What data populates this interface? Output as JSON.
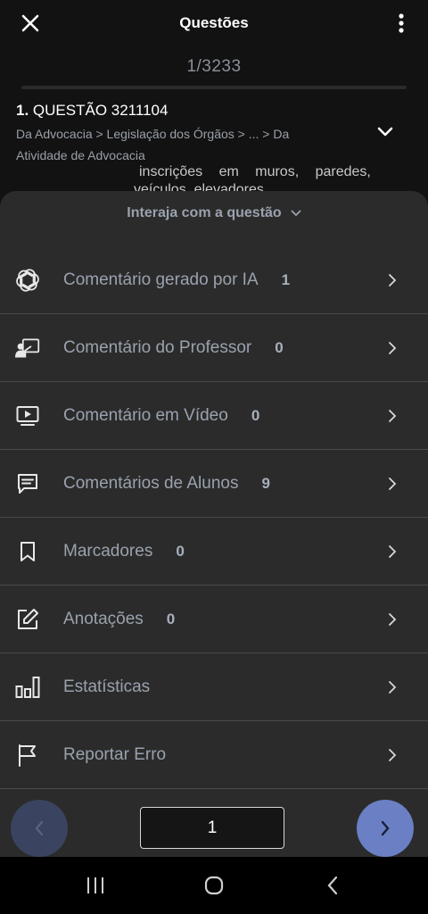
{
  "header": {
    "title": "Questões",
    "close_icon": "close-icon",
    "more_icon": "more-vertical-icon"
  },
  "counter": "1/3233",
  "question": {
    "number": "1.",
    "title": "QUESTÃO 3211104",
    "breadcrumb_line1": "Da Advocacia > Legislação dos Órgãos > ... > Da",
    "breadcrumb_line2": "Atividade de Advocacia",
    "behind_text": "inscrições em muros, paredes,",
    "behind_text2": "veículos, elevadores"
  },
  "sheet": {
    "toggle_label": "Interaja com a questão"
  },
  "menu": {
    "items": [
      {
        "icon": "ai-openai-icon",
        "label": "Comentário gerado por IA",
        "count": "1"
      },
      {
        "icon": "teacher-icon",
        "label": "Comentário do Professor",
        "count": "0"
      },
      {
        "icon": "video-icon",
        "label": "Comentário em Vídeo",
        "count": "0"
      },
      {
        "icon": "comment-icon",
        "label": "Comentários de Alunos",
        "count": "9"
      },
      {
        "icon": "bookmark-icon",
        "label": "Marcadores",
        "count": "0"
      },
      {
        "icon": "edit-note-icon",
        "label": "Anotações",
        "count": "0"
      },
      {
        "icon": "bar-chart-icon",
        "label": "Estatísticas",
        "count": ""
      },
      {
        "icon": "flag-icon",
        "label": "Reportar Erro",
        "count": ""
      }
    ]
  },
  "pager": {
    "page_value": "1",
    "prev_icon": "chevron-left-icon",
    "next_icon": "chevron-right-icon"
  },
  "colors": {
    "background": "#121212",
    "sheet": "#2b2b2b",
    "accent": "#6a7fc4",
    "accent_disabled": "#3a4460",
    "muted_text": "#9aa2ae"
  }
}
